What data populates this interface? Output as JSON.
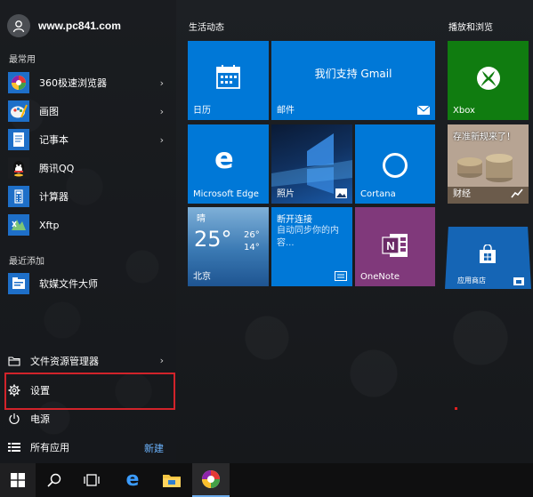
{
  "user": {
    "name": "www.pc841.com",
    "icon": "user-avatar-icon"
  },
  "most_used": {
    "label": "最常用",
    "items": [
      {
        "label": "360极速浏览器",
        "icon": "360-browser-icon",
        "has_arrow": true
      },
      {
        "label": "画图",
        "icon": "paint-icon",
        "has_arrow": true
      },
      {
        "label": "记事本",
        "icon": "notepad-icon",
        "has_arrow": true
      },
      {
        "label": "腾讯QQ",
        "icon": "qq-icon",
        "has_arrow": false
      },
      {
        "label": "计算器",
        "icon": "calculator-icon",
        "has_arrow": false
      },
      {
        "label": "Xftp",
        "icon": "xftp-icon",
        "has_arrow": false
      }
    ]
  },
  "recently_added": {
    "label": "最近添加",
    "items": [
      {
        "label": "软媒文件大师",
        "icon": "file-master-icon"
      }
    ]
  },
  "system": {
    "explorer": "文件资源管理器",
    "settings": "设置",
    "power": "电源",
    "all_apps": "所有应用",
    "new": "新建"
  },
  "groups": {
    "life": "生活动态",
    "play": "播放和浏览"
  },
  "tiles": {
    "calendar": {
      "label": "日历"
    },
    "mail": {
      "label": "邮件",
      "headline": "我们支持 Gmail"
    },
    "xbox": {
      "label": "Xbox"
    },
    "edge": {
      "label": "Microsoft Edge"
    },
    "photos": {
      "label": "照片"
    },
    "cortana": {
      "label": "Cortana"
    },
    "finance": {
      "label": "财经",
      "headline": "存准新规来了！"
    },
    "weather": {
      "condition": "晴",
      "temp": "25°",
      "high": "26°",
      "low": "14°",
      "city": "北京"
    },
    "connect": {
      "title": "断开连接",
      "body": "自动同步你的内容..."
    },
    "onenote": {
      "label": "OneNote"
    },
    "store": {
      "label": "应用商店"
    }
  },
  "colors": {
    "tile_blue": "#0078d7",
    "xbox_green": "#107c10",
    "onenote_purple": "#80397b",
    "highlight_red": "#d2232a",
    "link_blue": "#6cb4ff"
  },
  "taskbar": {
    "items": [
      "start-icon",
      "search-icon",
      "task-view-icon",
      "edge-icon",
      "file-explorer-icon",
      "360-browser-icon"
    ]
  }
}
